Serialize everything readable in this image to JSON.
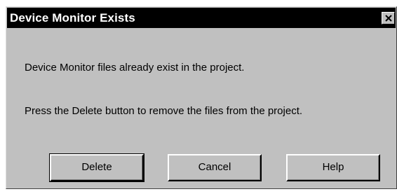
{
  "dialog": {
    "title": "Device Monitor Exists",
    "close_icon": "close-x-icon",
    "message_line1": "Device Monitor files already exist in the project.",
    "message_line2": "Press the Delete button to remove the files from the project."
  },
  "buttons": {
    "delete_label": "Delete",
    "cancel_label": "Cancel",
    "help_label": "Help"
  },
  "colors": {
    "titlebar_bg": "#000000",
    "dialog_bg": "#c0c0c0"
  }
}
